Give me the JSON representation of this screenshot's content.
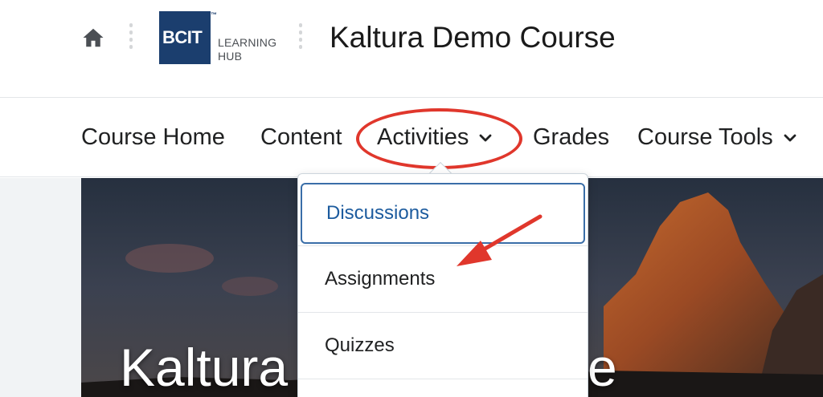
{
  "header": {
    "home_icon": "home-icon",
    "logo": {
      "brand": "BCIT",
      "trademark": "™",
      "line1": "LEARNING",
      "line2": "HUB",
      "color": "#1b3e6e"
    },
    "course_title": "Kaltura Demo Course"
  },
  "navbar": {
    "items": [
      {
        "label": "Course Home"
      },
      {
        "label": "Content"
      },
      {
        "label": "Activities",
        "icon": "chevron-down-icon"
      },
      {
        "label": "Grades"
      },
      {
        "label": "Course Tools",
        "icon": "chevron-down-icon"
      }
    ]
  },
  "dropdown": {
    "items": [
      {
        "label": "Discussions",
        "focused": true
      },
      {
        "label": "Assignments"
      },
      {
        "label": "Quizzes"
      }
    ]
  },
  "banner": {
    "title_left": "Kaltura",
    "title_right": "e"
  },
  "annotations": {
    "highlight_color": "#e0372c"
  }
}
